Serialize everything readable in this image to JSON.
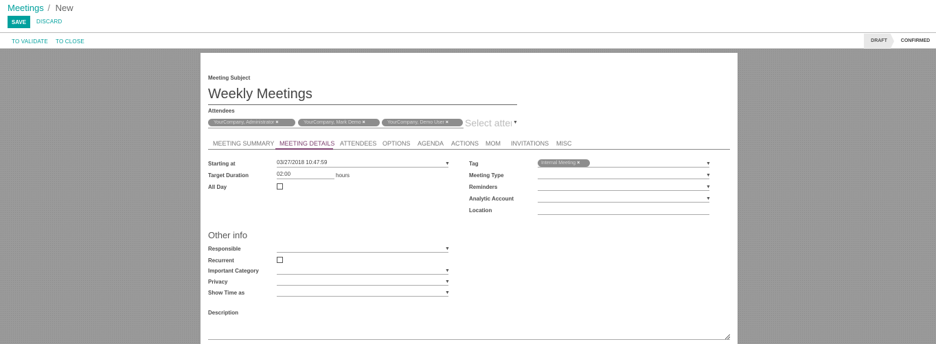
{
  "breadcrumb": {
    "parent": "Meetings",
    "separator": "/",
    "current": "New"
  },
  "toolbar": {
    "save_label": "SAVE",
    "discard_label": "DISCARD"
  },
  "statusbar": {
    "buttons": [
      "TO VALIDATE",
      "TO CLOSE"
    ],
    "stages": [
      {
        "label": "DRAFT",
        "active": true
      },
      {
        "label": "CONFIRMED",
        "active": false
      }
    ]
  },
  "form": {
    "subject_label": "Meeting Subject",
    "subject_value": "Weekly Meetings",
    "attendees_label": "Attendees",
    "attendees": [
      "YourCompany, Administrator",
      "YourCompany, Mark Demo",
      "YourCompany, Demo User"
    ],
    "attendees_placeholder": "Select atten",
    "tabs": [
      "MEETING SUMMARY",
      "MEETING DETAILS",
      "ATTENDEES",
      "OPTIONS",
      "AGENDA",
      "ACTIONS",
      "MOM",
      "INVITATIONS",
      "MISC"
    ],
    "active_tab": "MEETING DETAILS",
    "left_fields": {
      "starting_at_label": "Starting at",
      "starting_at_value": "03/27/2018 10:47:59",
      "duration_label": "Target Duration",
      "duration_value": "02:00",
      "duration_unit": "hours",
      "all_day_label": "All Day",
      "all_day_checked": false
    },
    "right_fields": {
      "tag_label": "Tag",
      "tag_value": "Internal Meeting",
      "meeting_type_label": "Meeting Type",
      "reminders_label": "Reminders",
      "analytic_label": "Analytic Account",
      "location_label": "Location"
    },
    "other_info": {
      "title": "Other info",
      "responsible_label": "Responsible",
      "recurrent_label": "Recurrent",
      "recurrent_checked": false,
      "category_label": "Important Category",
      "privacy_label": "Privacy",
      "show_time_label": "Show Time as"
    },
    "description_label": "Description"
  },
  "colors": {
    "primary": "#00a09d",
    "tab_active": "#7c3f6e",
    "background": "#9a9a9a"
  }
}
